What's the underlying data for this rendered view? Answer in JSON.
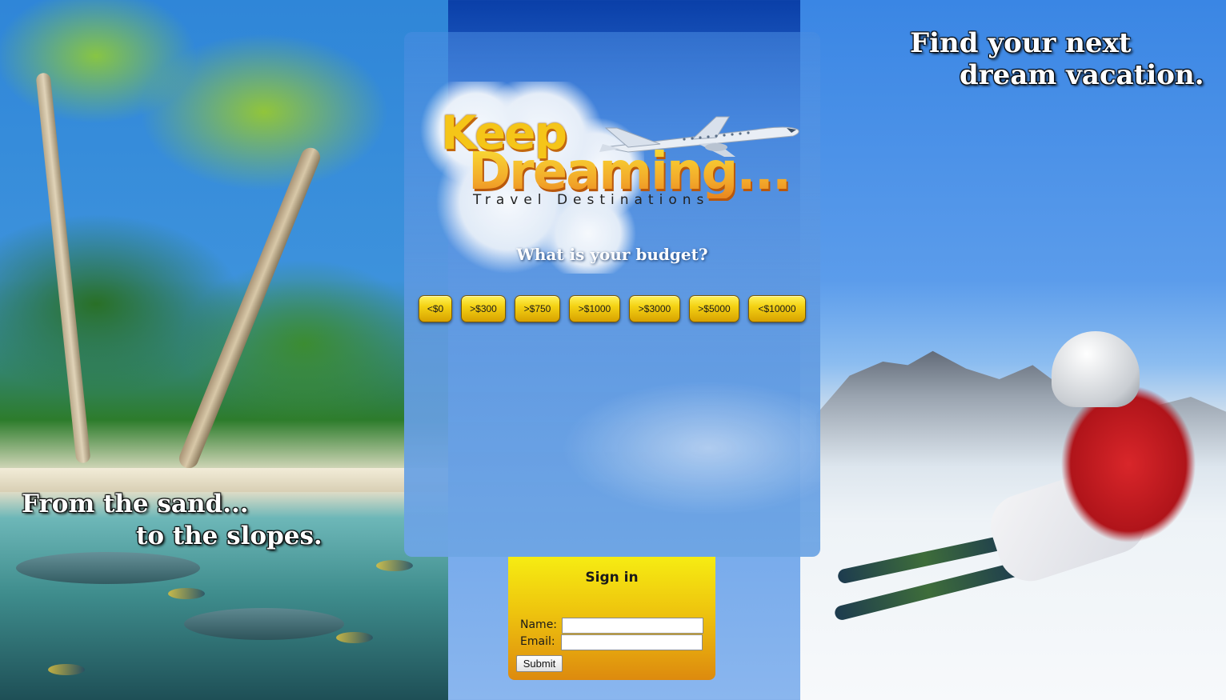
{
  "taglines": {
    "top_line_1": "Find your next",
    "top_line_2": "dream vacation.",
    "bottom_line_1": "From the sand...",
    "bottom_line_2": "to the slopes."
  },
  "logo": {
    "word_1": "Keep",
    "word_2": "Dreaming...",
    "subtitle": "Travel Destinations"
  },
  "budget": {
    "question": "What is your budget?",
    "options": [
      "<$0",
      ">$300",
      ">$750",
      ">$1000",
      ">$3000",
      ">$5000",
      "<$10000"
    ]
  },
  "signin": {
    "title": "Sign in",
    "name_label": "Name:",
    "email_label": "Email:",
    "name_value": "",
    "email_value": "",
    "submit_label": "Submit"
  },
  "colors": {
    "button_gold": "#f4d214",
    "signin_top": "#f6ec12",
    "signin_bottom": "#dd8a0e",
    "panel_blue": "#629be1"
  }
}
